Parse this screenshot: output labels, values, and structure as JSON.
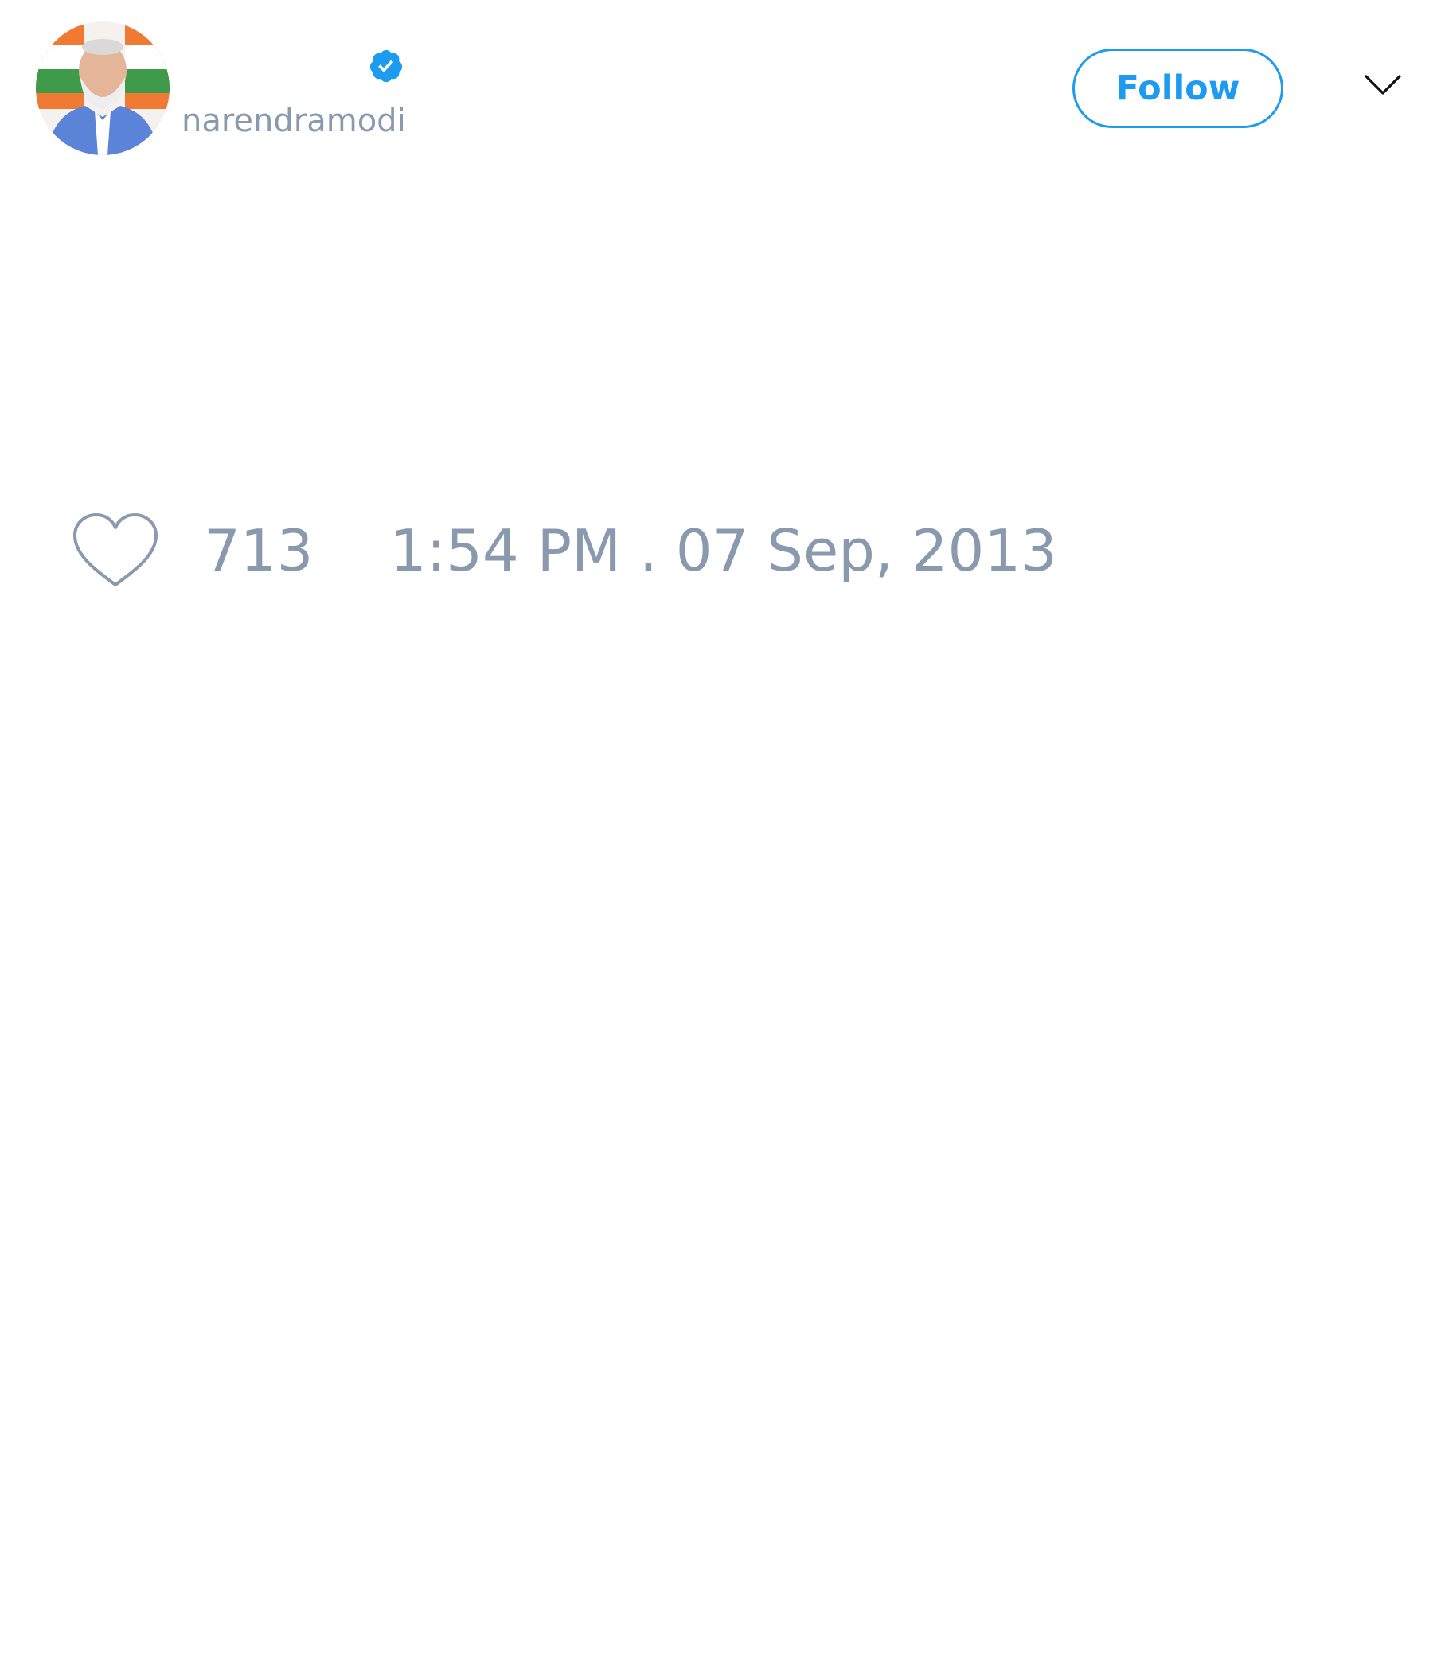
{
  "tweet": {
    "author": {
      "handle": "narendramodi",
      "verified_icon": "verified-badge-icon",
      "avatar": "profile-photo"
    },
    "follow_label": "Follow",
    "menu_icon": "chevron-down-icon",
    "like_icon": "heart-icon",
    "like_count": "713",
    "timestamp": "1:54 PM . 07 Sep, 2013"
  },
  "colors": {
    "accent": "#1d9bf0",
    "muted_text": "#8a9aae",
    "background": "#ffffff"
  }
}
